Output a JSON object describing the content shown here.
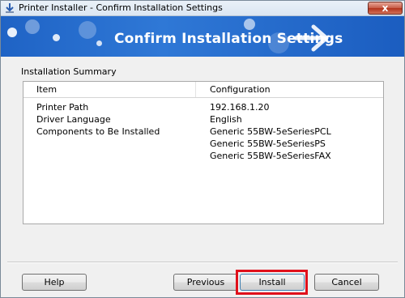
{
  "window": {
    "title": "Printer Installer - Confirm Installation Settings",
    "close_label": "x"
  },
  "banner": {
    "heading": "Confirm Installation Settings",
    "arrow_icon": "right-arrow-icon"
  },
  "summary": {
    "group_label": "Installation Summary",
    "columns": [
      "Item",
      "Configuration"
    ],
    "rows": [
      {
        "item": "Printer Path",
        "config": "192.168.1.20"
      },
      {
        "item": "Driver Language",
        "config": "English"
      },
      {
        "item": "Components to Be Installed",
        "config": "Generic 55BW-5eSeriesPCL"
      },
      {
        "item": "",
        "config": "Generic 55BW-5eSeriesPS"
      },
      {
        "item": "",
        "config": "Generic 55BW-5eSeriesFAX"
      }
    ]
  },
  "buttons": {
    "help": "Help",
    "previous": "Previous",
    "install": "Install",
    "cancel": "Cancel"
  },
  "colors": {
    "banner": "#2f78d6",
    "highlight": "#e0101b"
  }
}
